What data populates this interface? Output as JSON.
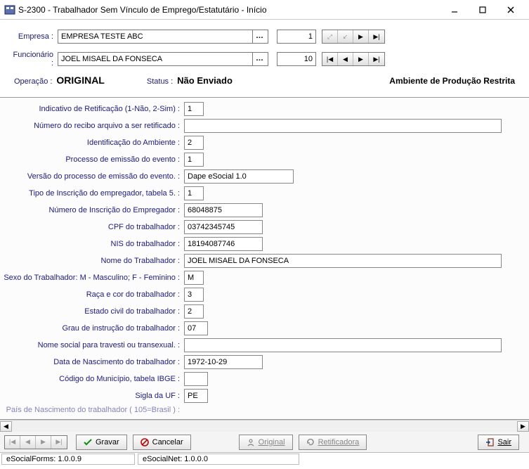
{
  "window": {
    "title": "S-2300 - Trabalhador Sem Vínculo de Emprego/Estatutário - Início"
  },
  "top": {
    "empresa_label": "Empresa :",
    "empresa_value": "EMPRESA TESTE ABC",
    "empresa_num": "1",
    "funcionario_label": "Funcionário :",
    "funcionario_value": "JOEL MISAEL DA FONSECA",
    "funcionario_num": "10"
  },
  "status": {
    "op_label": "Operação :",
    "op_value": "ORIGINAL",
    "st_label": "Status :",
    "st_value": "Não Enviado",
    "ambiente": "Ambiente de Produção Restrita"
  },
  "fields": [
    {
      "label": "Indicativo de Retificação (1-Não, 2-Sim) :",
      "value": "1",
      "size": "small"
    },
    {
      "label": "Número do recibo arquivo a ser retificado :",
      "value": "",
      "size": "wide"
    },
    {
      "label": "Identificação do Ambiente :",
      "value": "2",
      "size": "small"
    },
    {
      "label": "Processo de emissão do evento :",
      "value": "1",
      "size": "small"
    },
    {
      "label": "Versão do processo de emissão do evento. :",
      "value": "Dape eSocial 1.0",
      "size": "med2"
    },
    {
      "label": "Tipo de Inscrição do empregador, tabela 5. :",
      "value": "1",
      "size": "small"
    },
    {
      "label": "Número de Inscrição do Empregador :",
      "value": "68048875",
      "size": "med"
    },
    {
      "label": "CPF do trabalhador :",
      "value": "03742345745",
      "size": "med"
    },
    {
      "label": "NIS do trabalhador :",
      "value": "18194087746",
      "size": "med"
    },
    {
      "label": "Nome do Trabalhador :",
      "value": "JOEL MISAEL DA FONSECA",
      "size": "wide"
    },
    {
      "label": "Sexo do Trabalhador: M - Masculino; F - Feminino :",
      "value": "M",
      "size": "small"
    },
    {
      "label": "Raça e cor do trabalhador :",
      "value": "3",
      "size": "small"
    },
    {
      "label": "Estado civil do trabalhador :",
      "value": "2",
      "size": "small"
    },
    {
      "label": "Grau de instrução do trabalhador :",
      "value": "07",
      "size": "tiny"
    },
    {
      "label": "Nome social para travesti ou transexual. :",
      "value": "",
      "size": "wide"
    },
    {
      "label": "Data de Nascimento do trabalhador :",
      "value": "1972-10-29",
      "size": "med"
    },
    {
      "label": "Código do Município, tabela IBGE :",
      "value": "",
      "size": "tiny"
    },
    {
      "label": "Sigla da UF :",
      "value": "PE",
      "size": "tiny"
    }
  ],
  "truncated_label": "País de Nascimento do trabalhador ( 105=Brasil ) :",
  "buttons": {
    "gravar": "Gravar",
    "cancelar": "Cancelar",
    "original": "Original",
    "retificadora": "Retificadora",
    "sair": "Sair"
  },
  "statusbar": {
    "forms": "eSocialForms: 1.0.0.9",
    "net": "eSocialNet: 1.0.0.0"
  }
}
